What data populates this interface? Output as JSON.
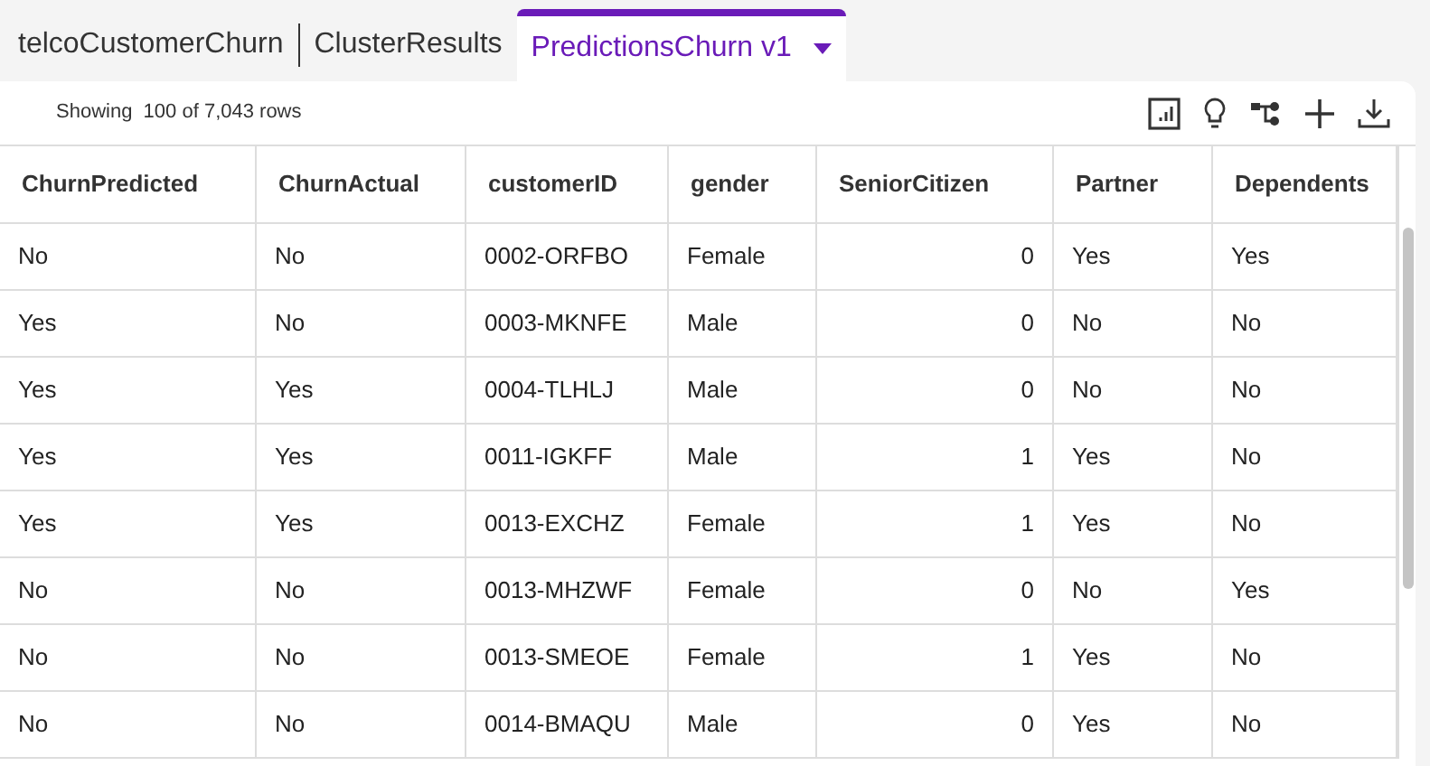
{
  "tabs": [
    {
      "label": "telcoCustomerChurn",
      "selected": false
    },
    {
      "label": "ClusterResults",
      "selected": false
    },
    {
      "label": "PredictionsChurn v1",
      "selected": true,
      "dropdown": true
    }
  ],
  "row_count": "Showing  100 of 7,043 rows",
  "table": {
    "columns": [
      {
        "label": "ChurnPredicted",
        "kind": "text"
      },
      {
        "label": "ChurnActual",
        "kind": "text"
      },
      {
        "label": "customerID",
        "kind": "text"
      },
      {
        "label": "gender",
        "kind": "text"
      },
      {
        "label": "SeniorCitizen",
        "kind": "number"
      },
      {
        "label": "Partner",
        "kind": "text"
      },
      {
        "label": "Dependents",
        "kind": "text"
      }
    ],
    "rows": [
      [
        "No",
        "No",
        "0002-ORFBO",
        "Female",
        "0",
        "Yes",
        "Yes"
      ],
      [
        "Yes",
        "No",
        "0003-MKNFE",
        "Male",
        "0",
        "No",
        "No"
      ],
      [
        "Yes",
        "Yes",
        "0004-TLHLJ",
        "Male",
        "0",
        "No",
        "No"
      ],
      [
        "Yes",
        "Yes",
        "0011-IGKFF",
        "Male",
        "1",
        "Yes",
        "No"
      ],
      [
        "Yes",
        "Yes",
        "0013-EXCHZ",
        "Female",
        "1",
        "Yes",
        "No"
      ],
      [
        "No",
        "No",
        "0013-MHZWF",
        "Female",
        "0",
        "No",
        "Yes"
      ],
      [
        "No",
        "No",
        "0013-SMEOE",
        "Female",
        "1",
        "Yes",
        "No"
      ],
      [
        "No",
        "No",
        "0014-BMAQU",
        "Male",
        "0",
        "Yes",
        "No"
      ]
    ]
  }
}
